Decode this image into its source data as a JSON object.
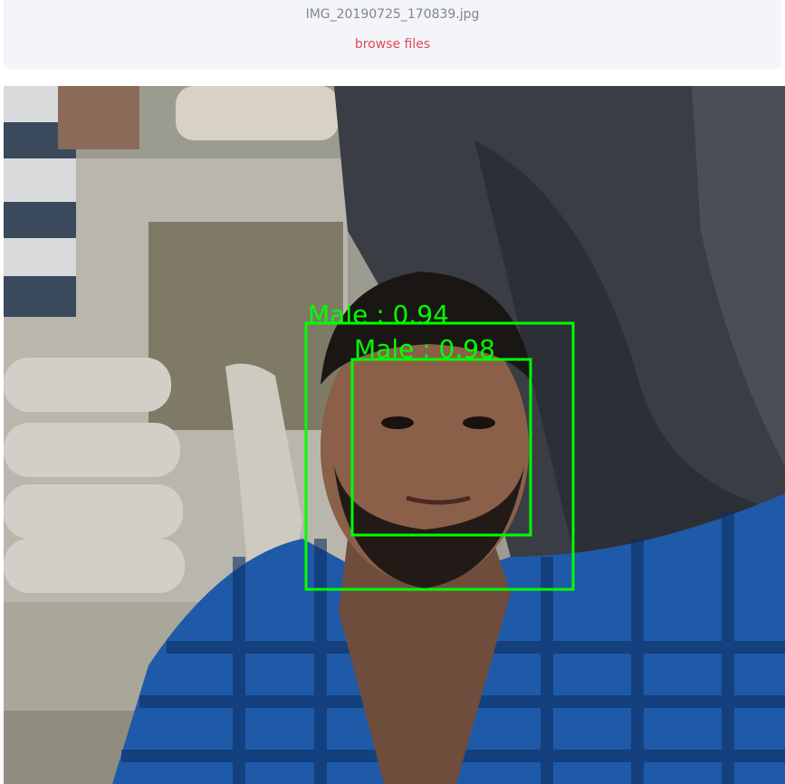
{
  "uploader": {
    "file_name": "IMG_20190725_170839.jpg",
    "browse_label": "browse files"
  },
  "image": {
    "detections": [
      {
        "label": "Male : 0.94",
        "color": "#00ff00"
      },
      {
        "label": "Male : 0.98",
        "color": "#00ff00"
      }
    ]
  },
  "colors": {
    "uploader_bg": "#f4f5f8",
    "browse_link": "#e0485a",
    "box": "#00ff00"
  }
}
